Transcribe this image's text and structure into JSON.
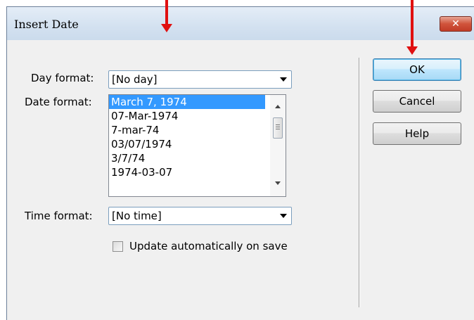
{
  "window": {
    "title": "Insert Date",
    "close_glyph": "✕"
  },
  "form": {
    "day_format_label": "Day format:",
    "day_format_value": "[No day]",
    "date_format_label": "Date format:",
    "date_formats": [
      {
        "label": "March 7, 1974",
        "selected": true
      },
      {
        "label": "07-Mar-1974",
        "selected": false
      },
      {
        "label": "7-mar-74",
        "selected": false
      },
      {
        "label": "03/07/1974",
        "selected": false
      },
      {
        "label": "3/7/74",
        "selected": false
      },
      {
        "label": "1974-03-07",
        "selected": false
      }
    ],
    "time_format_label": "Time format:",
    "time_format_value": "[No time]",
    "update_checkbox_label": "Update automatically on save",
    "update_checkbox_checked": false
  },
  "buttons": {
    "ok": "OK",
    "cancel": "Cancel",
    "help": "Help"
  },
  "annotation_color": "#e01010"
}
